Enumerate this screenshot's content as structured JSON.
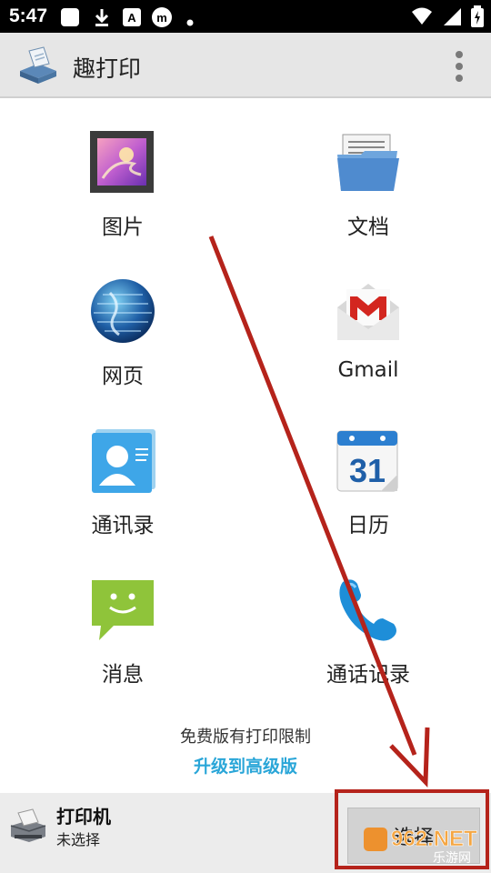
{
  "status_bar": {
    "time": "5:47"
  },
  "app_bar": {
    "title": "趣打印"
  },
  "tiles": [
    {
      "label": "图片"
    },
    {
      "label": "文档"
    },
    {
      "label": "网页"
    },
    {
      "label": "Gmail"
    },
    {
      "label": "通讯录"
    },
    {
      "label": "日历"
    },
    {
      "label": "消息"
    },
    {
      "label": "通话记录"
    }
  ],
  "calendar_day": "31",
  "notice": {
    "text": "免费版有打印限制",
    "upgrade_link": "升级到高级版"
  },
  "printer": {
    "label": "打印机",
    "status": "未选择",
    "select_button": "选择"
  },
  "watermark": {
    "text": "962.NET",
    "subtext": "乐游网"
  },
  "colors": {
    "link": "#2aa6d8",
    "annotation": "#b5231b",
    "appbar": "#e6e6e6"
  }
}
